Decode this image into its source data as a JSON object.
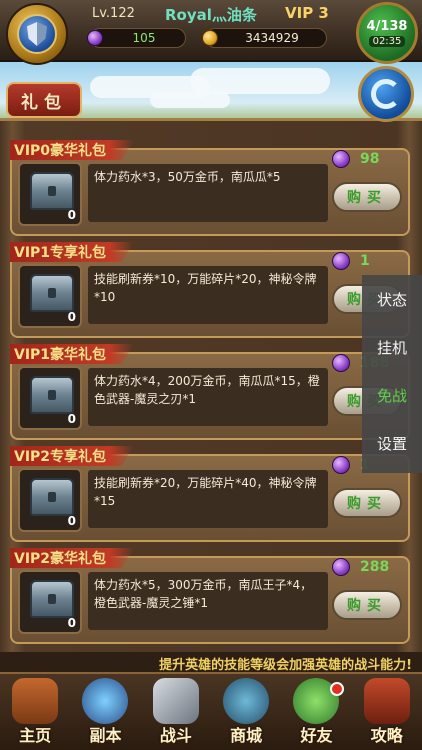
{
  "header": {
    "level": "Lv.122",
    "player_name": "Royal灬油条",
    "vip": "VIP 3",
    "gems": "105",
    "gold": "3434929",
    "stamina": "4/138",
    "timer": "02:35"
  },
  "tab_title": "礼包",
  "packs": [
    {
      "title": "VIP0豪华礼包",
      "desc": "体力药水*3，50万金币，南瓜瓜*5",
      "count": "0",
      "price": "98",
      "buy": "购买"
    },
    {
      "title": "VIP1专享礼包",
      "desc": "技能刷新券*10，万能碎片*20，神秘令牌*10",
      "count": "0",
      "price": "1",
      "buy": "购买"
    },
    {
      "title": "VIP1豪华礼包",
      "desc": "体力药水*4，200万金币，南瓜瓜*15，橙色武器-魔灵之刃*1",
      "count": "0",
      "price": "188",
      "buy": "购买"
    },
    {
      "title": "VIP2专享礼包",
      "desc": "技能刷新券*20，万能碎片*40，神秘令牌*15",
      "count": "0",
      "price": "1",
      "buy": "购买"
    },
    {
      "title": "VIP2豪华礼包",
      "desc": "体力药水*5，300万金币，南瓜王子*4，橙色武器-魔灵之锤*1",
      "count": "0",
      "price": "288",
      "buy": "购买"
    }
  ],
  "side_menu": [
    "状态",
    "挂机",
    "免战",
    "设置"
  ],
  "tip": "提升英雄的技能等级会加强英雄的战斗能力!",
  "nav": [
    "主页",
    "副本",
    "战斗",
    "商城",
    "好友",
    "攻略"
  ],
  "colors": {
    "accent_green": "#79d85a",
    "title_gold": "#f6e088",
    "tab_red": "#a3251a"
  }
}
